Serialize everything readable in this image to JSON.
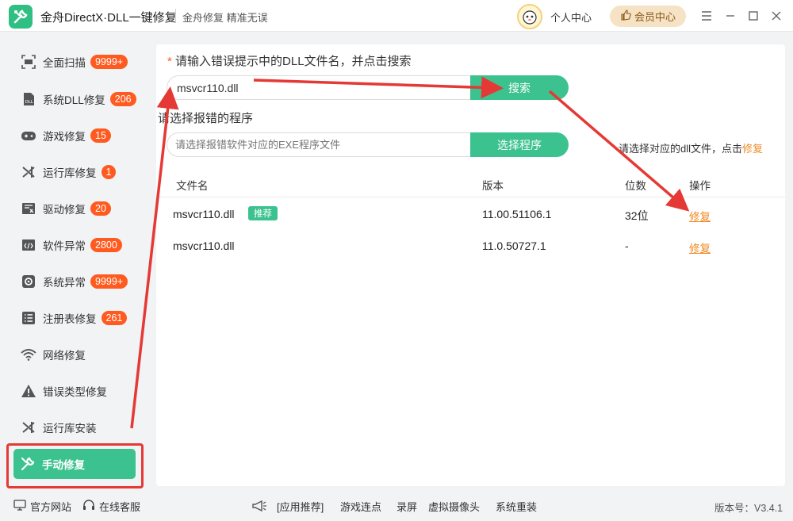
{
  "titlebar": {
    "app_title": "金舟DirectX·DLL一键修复",
    "slogan": "金舟修复 精准无误",
    "personal_center": "个人中心",
    "vip_center": "会员中心"
  },
  "sidebar": {
    "items": [
      {
        "label": "全面扫描",
        "badge": "9999+",
        "icon": "scan-icon"
      },
      {
        "label": "系统DLL修复",
        "badge": "206",
        "icon": "dll-icon"
      },
      {
        "label": "游戏修复",
        "badge": "15",
        "icon": "gamepad-icon"
      },
      {
        "label": "运行库修复",
        "badge": "1",
        "icon": "runtime-icon"
      },
      {
        "label": "驱动修复",
        "badge": "20",
        "icon": "driver-icon"
      },
      {
        "label": "软件异常",
        "badge": "2800",
        "icon": "code-icon"
      },
      {
        "label": "系统异常",
        "badge": "9999+",
        "icon": "gear-icon"
      },
      {
        "label": "注册表修复",
        "badge": "261",
        "icon": "registry-icon"
      },
      {
        "label": "网络修复",
        "badge": "",
        "icon": "wifi-icon"
      },
      {
        "label": "错误类型修复",
        "badge": "",
        "icon": "warning-icon"
      },
      {
        "label": "运行库安装",
        "badge": "",
        "icon": "runtime-install-icon"
      },
      {
        "label": "手动修复",
        "badge": "",
        "icon": "wrench-icon"
      }
    ]
  },
  "main": {
    "prompt_star": "*",
    "prompt_dll": "请输入错误提示中的DLL文件名，并点击搜索",
    "search_value": "msvcr110.dll",
    "search_button": "搜索",
    "prompt_program": "请选择报错的程序",
    "program_placeholder": "请选择报错软件对应的EXE程序文件",
    "program_button": "选择程序",
    "hint_text": "请选择对应的dll文件，点击",
    "hint_highlight": "修复",
    "table": {
      "headers": [
        "文件名",
        "版本",
        "位数",
        "操作"
      ],
      "rows": [
        {
          "file": "msvcr110.dll",
          "tag": "推荐",
          "version": "11.00.51106.1",
          "bits": "32位",
          "action": "修复"
        },
        {
          "file": "msvcr110.dll",
          "tag": "",
          "version": "11.0.50727.1",
          "bits": "-",
          "action": "修复"
        }
      ]
    }
  },
  "footer": {
    "official_site": "官方网站",
    "online_service": "在线客服",
    "app_recommend": "[应用推荐]",
    "links": [
      "游戏连点",
      "录屏",
      "虚拟摄像头",
      "系统重装"
    ],
    "version": "版本号：V3.4.1"
  },
  "colors": {
    "accent": "#3cc28f",
    "badge": "#ff5a1f",
    "link": "#f08a24",
    "annotation": "#e53935"
  }
}
